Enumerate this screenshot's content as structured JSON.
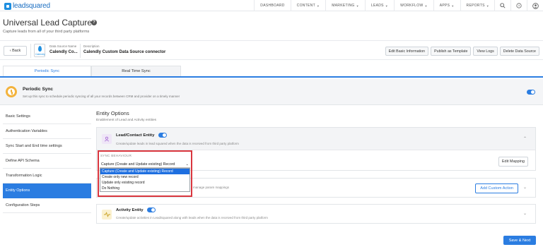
{
  "app": {
    "logo_text": "leadsquared",
    "nav": [
      "DASHBOARD",
      "CONTENT",
      "MARKETING",
      "LEADS",
      "WORKFLOW",
      "APPS",
      "REPORTS"
    ],
    "nav_icons": [
      "search-icon",
      "help-icon",
      "user-icon"
    ]
  },
  "page": {
    "title": "Universal Lead Capture",
    "subtitle": "Capture leads from all of your third party platforms"
  },
  "toolbar": {
    "back_label": "‹ Back",
    "ds_icon_label": "Calendly",
    "ds_name_label": "Data Source Name",
    "ds_name_value": "Calendly Co...",
    "description_label": "Description",
    "description_value": "Calendly Custom Data Source connector",
    "buttons": [
      "Edit Basic Information",
      "Publish as Template",
      "View Logs",
      "Delete Data Source"
    ]
  },
  "tabs": {
    "periodic": "Periodic Sync",
    "realtime": "Real Time Sync"
  },
  "periodic": {
    "title": "Periodic Sync",
    "desc": "Set up this sync to schedule periodic syncing of all your records between CRM and provider on a timely manner",
    "enabled": true
  },
  "sidebar": {
    "items": [
      {
        "label": "Basic Settings"
      },
      {
        "label": "Authentication Variables"
      },
      {
        "label": "Sync Start and End time settings"
      },
      {
        "label": "Define API Schema"
      },
      {
        "label": "Transformation Logic"
      },
      {
        "label": "Entity Options",
        "active": true
      },
      {
        "label": "Configuration Steps"
      }
    ]
  },
  "main": {
    "title": "Entity Options",
    "subtitle": "Enablement of Lead and Activity entities",
    "lead": {
      "title": "Lead/Contact Entity",
      "desc": "Create/update leads in lead squared when the data is received from third party platform",
      "enabled": true,
      "edit_mapping": "Edit Mapping"
    },
    "custom": {
      "desc": "manage param mappings",
      "add_button": "Add Custom Action"
    },
    "activity": {
      "title": "Activity Entity",
      "desc": "Create/update activities in LeadSquared along with leads when the data is received from third party platform",
      "enabled": true
    }
  },
  "sync_behaviour": {
    "label": "SYNC BEHAVIOUR",
    "selected": "Capture (Create and Update existing) Record",
    "options": [
      "Capture (Create and Update existing) Record",
      "Create only new record",
      "Update only existing record",
      "Do Nothing"
    ]
  },
  "footer": {
    "save_next": "Save & Next"
  },
  "colors": {
    "primary": "#2b7de1",
    "highlight_border": "#d9363e",
    "periodic_icon": "#f3b33d"
  }
}
